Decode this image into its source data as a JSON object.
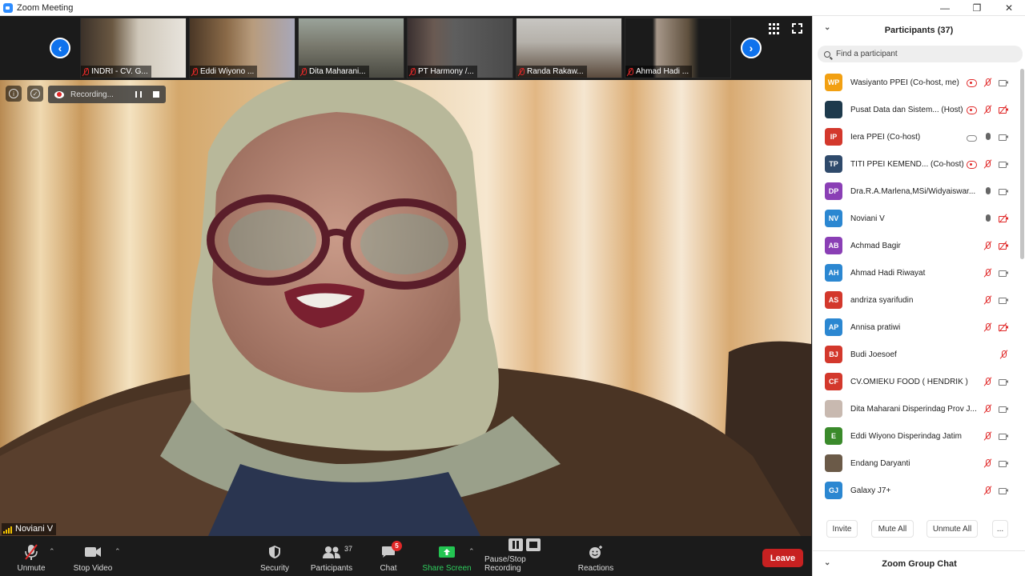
{
  "window": {
    "title": "Zoom Meeting"
  },
  "thumbnails": [
    {
      "name": "INDRI - CV. G..."
    },
    {
      "name": "Eddi Wiyono ..."
    },
    {
      "name": "Dita Maharani..."
    },
    {
      "name": "PT Harmony /..."
    },
    {
      "name": "Randa Rakaw..."
    },
    {
      "name": "Ahmad Hadi ..."
    }
  ],
  "main_video": {
    "speaker": "Noviani V",
    "recording_label": "Recording..."
  },
  "toolbar": {
    "unmute": "Unmute",
    "stop_video": "Stop Video",
    "security": "Security",
    "participants": "Participants",
    "participants_count": "37",
    "chat": "Chat",
    "chat_badge": "5",
    "share_screen": "Share Screen",
    "pause_stop_recording": "Pause/Stop Recording",
    "reactions": "Reactions",
    "leave": "Leave"
  },
  "panel": {
    "title": "Participants (37)",
    "search_placeholder": "Find a participant",
    "participants": [
      {
        "initials": "WP",
        "name": "Wasiyanto PPEI (Co-host, me)",
        "color": "#f2a012",
        "icons": [
          "rec",
          "mic-off",
          "cam"
        ]
      },
      {
        "initials": "",
        "name": "Pusat Data dan Sistem... (Host)",
        "color": "#1e3a4c",
        "icons": [
          "rec",
          "mic-off",
          "cam-off"
        ]
      },
      {
        "initials": "IP",
        "name": "Iera PPEI (Co-host)",
        "color": "#d3382c",
        "icons": [
          "cloud",
          "mic",
          "cam"
        ]
      },
      {
        "initials": "TP",
        "name": "TITI PPEI KEMEND...   (Co-host)",
        "color": "#2f4a6b",
        "icons": [
          "rec",
          "mic-off",
          "cam"
        ]
      },
      {
        "initials": "DP",
        "name": "Dra.R.A.Marlena,MSi/Widyaiswar...",
        "color": "#8a3fb5",
        "icons": [
          "mic",
          "cam"
        ]
      },
      {
        "initials": "NV",
        "name": "Noviani V",
        "color": "#2b87d1",
        "icons": [
          "mic",
          "cam-off"
        ]
      },
      {
        "initials": "AB",
        "name": "Achmad Bagir",
        "color": "#8a3fb5",
        "icons": [
          "mic-off",
          "cam-off"
        ]
      },
      {
        "initials": "AH",
        "name": "Ahmad Hadi Riwayat",
        "color": "#2b87d1",
        "icons": [
          "mic-off",
          "cam"
        ]
      },
      {
        "initials": "AS",
        "name": "andriza syarifudin",
        "color": "#d3382c",
        "icons": [
          "mic-off",
          "cam"
        ]
      },
      {
        "initials": "AP",
        "name": "Annisa pratiwi",
        "color": "#2b87d1",
        "icons": [
          "mic-off",
          "cam-off"
        ]
      },
      {
        "initials": "BJ",
        "name": "Budi Joesoef",
        "color": "#d3382c",
        "icons": [
          "mic-off"
        ]
      },
      {
        "initials": "CF",
        "name": "CV.OMIEKU FOOD ( HENDRIK )",
        "color": "#d3382c",
        "icons": [
          "mic-off",
          "cam"
        ]
      },
      {
        "initials": "",
        "name": "Dita Maharani Disperindag Prov J...",
        "color": "#c8b9b0",
        "icons": [
          "mic-off",
          "cam"
        ]
      },
      {
        "initials": "E",
        "name": "Eddi Wiyono Disperindag Jatim",
        "color": "#3a8a2b",
        "icons": [
          "mic-off",
          "cam"
        ]
      },
      {
        "initials": "",
        "name": "Endang Daryanti",
        "color": "#6b5a48",
        "icons": [
          "mic-off",
          "cam"
        ]
      },
      {
        "initials": "GJ",
        "name": "Galaxy J7+",
        "color": "#2b87d1",
        "icons": [
          "mic-off",
          "cam"
        ]
      },
      {
        "initials": "",
        "name": "",
        "color": "#e07020",
        "icons": []
      }
    ],
    "actions": {
      "invite": "Invite",
      "mute_all": "Mute All",
      "unmute_all": "Unmute All",
      "more": "..."
    },
    "chat_title": "Zoom Group Chat"
  }
}
